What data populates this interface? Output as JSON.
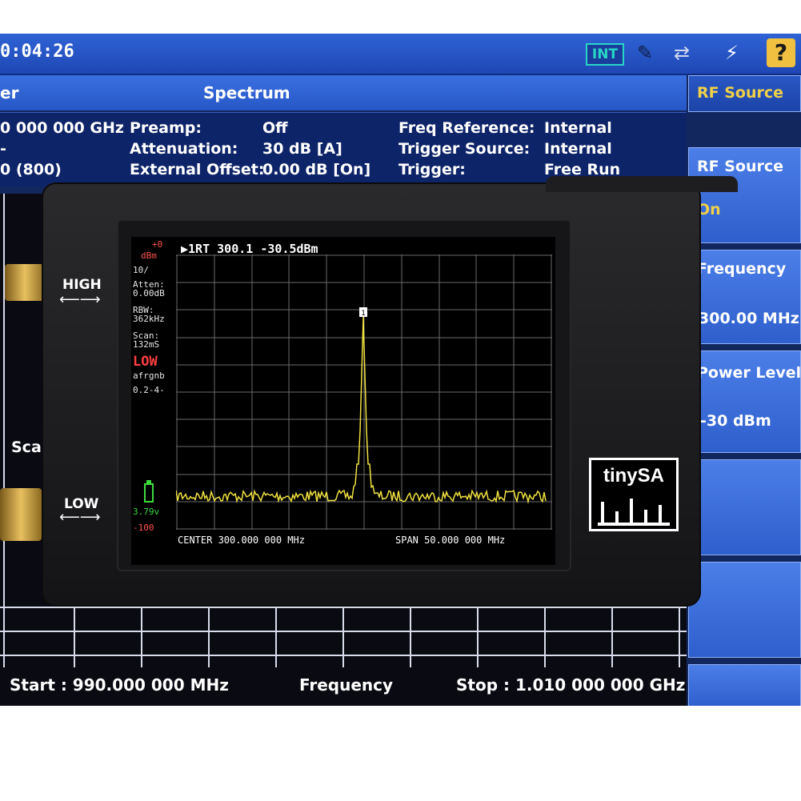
{
  "status_bar": {
    "clock": "0:04:26",
    "int_badge": "INT",
    "help": "?"
  },
  "title_bar": {
    "left": "er",
    "center": "Spectrum"
  },
  "info": {
    "col1": [
      "0 000 000 GHz",
      "-",
      "0 (800)"
    ],
    "col2_labels": [
      "Preamp:",
      "Attenuation:",
      "External Offset:"
    ],
    "col2_values": [
      "Off",
      "30 dB  [A]",
      "0.00 dB  [On]"
    ],
    "col3_labels": [
      "Freq Reference:",
      "Trigger Source:",
      "Trigger:"
    ],
    "col3_values": [
      "Internal",
      "Internal",
      "Free Run"
    ]
  },
  "right_menu": {
    "header": "RF Source",
    "items": [
      {
        "title": "RF Source",
        "value": "On"
      },
      {
        "title": "Frequency",
        "value": "300.00 MHz"
      },
      {
        "title": "Power Level",
        "value": "-30 dBm"
      }
    ]
  },
  "background_plot": {
    "scale_label": "Sca",
    "start": "Start : 990.000 000 MHz",
    "center_label": "Frequency",
    "stop": "Stop : 1.010 000 000 GHz"
  },
  "device": {
    "port_high": "HIGH",
    "port_low": "LOW",
    "logo": "tinySA",
    "lcd": {
      "ref_level": "+0",
      "ref_unit": "dBm",
      "scale": "10/",
      "atten_label": "Atten:",
      "atten_value": "0.00dB",
      "rbw_label": "RBW:",
      "rbw_value": "362kHz",
      "scan_label": "Scan:",
      "scan_value": "132mS",
      "mode": "LOW",
      "flags": "afrgnb",
      "version": "0.2-4-",
      "battery": "3.79v",
      "bottom_level": "-100",
      "marker": "▶1RT  300.1 -30.5dBm",
      "marker_number": "1",
      "center": "CENTER 300.000 000 MHz",
      "span": "SPAN 50.000 000 MHz"
    }
  },
  "colors": {
    "trace": "#f0e040",
    "mode_low": "#ff4040",
    "battery": "#3cdc3c",
    "menu_header_text": "#f0d048",
    "menu_value_text": "#f0d048"
  }
}
